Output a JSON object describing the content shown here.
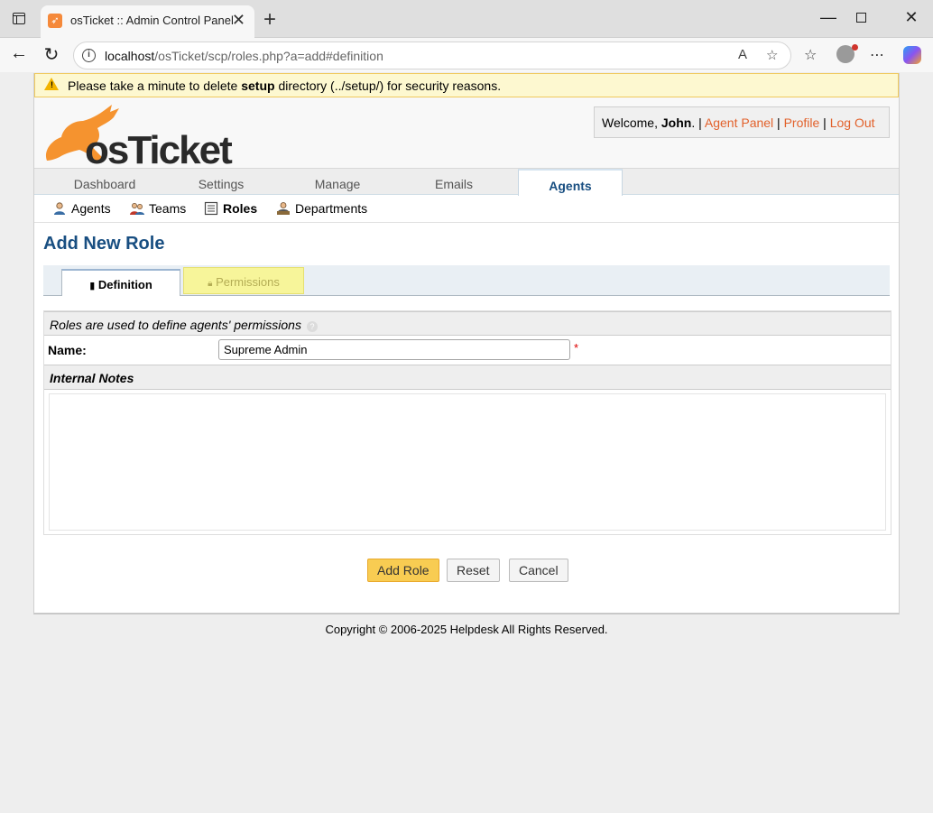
{
  "browser": {
    "tab_title": "osTicket :: Admin Control Panel",
    "url_host": "localhost",
    "url_path": "/osTicket/scp/roles.php?a=add#definition"
  },
  "notice": {
    "prefix": "Please take a minute to delete ",
    "bold": "setup",
    "suffix": " directory (../setup/) for security reasons."
  },
  "header": {
    "logo_text": "osTicket",
    "welcome_prefix": "Welcome, ",
    "user": "John",
    "sep1": ". | ",
    "agent_panel": "Agent Panel",
    "sep2": " | ",
    "profile": "Profile",
    "sep3": " | ",
    "logout": "Log Out"
  },
  "nav": {
    "tabs": [
      {
        "label": "Dashboard"
      },
      {
        "label": "Settings"
      },
      {
        "label": "Manage"
      },
      {
        "label": "Emails"
      },
      {
        "label": "Agents"
      }
    ],
    "active": "Agents"
  },
  "subnav": {
    "items": [
      {
        "label": "Agents"
      },
      {
        "label": "Teams"
      },
      {
        "label": "Roles"
      },
      {
        "label": "Departments"
      }
    ],
    "active": "Roles"
  },
  "page": {
    "title": "Add New Role"
  },
  "tabs": {
    "definition": "Definition",
    "permissions": "Permissions"
  },
  "form": {
    "intro": "Roles are used to define agents' permissions",
    "name_label": "Name:",
    "name_value": "Supreme Admin",
    "required_mark": "*",
    "notes_header": "Internal Notes",
    "notes_value": ""
  },
  "buttons": {
    "add": "Add Role",
    "reset": "Reset",
    "cancel": "Cancel"
  },
  "footer": {
    "copyright": "Copyright © 2006-2025 Helpdesk All Rights Reserved."
  },
  "colors": {
    "brand_blue": "#184e81",
    "link_orange": "#e2612b",
    "primary_button": "#f8cc52",
    "notice_bg": "#fdf8d0"
  }
}
